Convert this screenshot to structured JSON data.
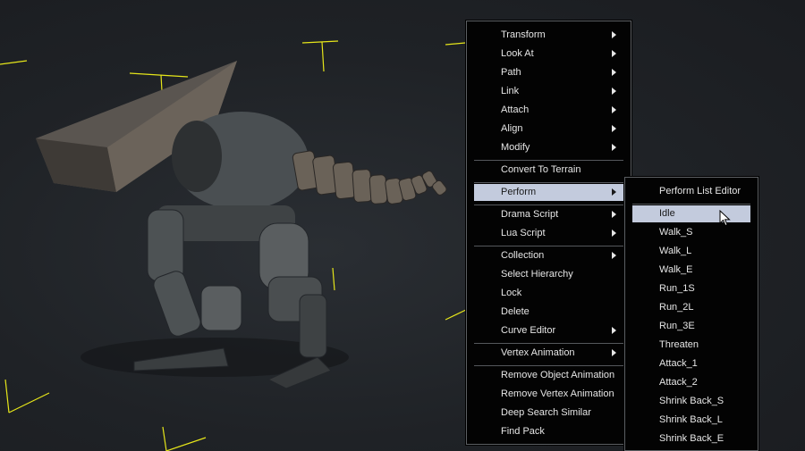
{
  "context_menu": {
    "groups": [
      [
        {
          "label": "Transform",
          "submenu": true
        },
        {
          "label": "Look At",
          "submenu": true
        },
        {
          "label": "Path",
          "submenu": true
        },
        {
          "label": "Link",
          "submenu": true
        },
        {
          "label": "Attach",
          "submenu": true
        },
        {
          "label": "Align",
          "submenu": true
        },
        {
          "label": "Modify",
          "submenu": true
        }
      ],
      [
        {
          "label": "Convert To Terrain",
          "submenu": false
        }
      ],
      [
        {
          "label": "Perform",
          "submenu": true,
          "highlighted": true
        }
      ],
      [
        {
          "label": "Drama Script",
          "submenu": true
        },
        {
          "label": "Lua Script",
          "submenu": true
        }
      ],
      [
        {
          "label": "Collection",
          "submenu": true
        },
        {
          "label": "Select Hierarchy",
          "submenu": false
        },
        {
          "label": "Lock",
          "submenu": false
        },
        {
          "label": "Delete",
          "submenu": false
        },
        {
          "label": "Curve Editor",
          "submenu": true
        }
      ],
      [
        {
          "label": "Vertex Animation",
          "submenu": true
        }
      ],
      [
        {
          "label": "Remove Object Animation",
          "submenu": false
        },
        {
          "label": "Remove Vertex Animation",
          "submenu": false
        },
        {
          "label": "Deep Search Similar",
          "submenu": false
        },
        {
          "label": "Find Pack",
          "submenu": false
        }
      ]
    ]
  },
  "perform_submenu": {
    "groups": [
      [
        {
          "label": "Perform List Editor"
        }
      ],
      [
        {
          "label": "Idle",
          "highlighted": true
        },
        {
          "label": "Walk_S"
        },
        {
          "label": "Walk_L"
        },
        {
          "label": "Walk_E"
        },
        {
          "label": "Run_1S"
        },
        {
          "label": "Run_2L"
        },
        {
          "label": "Run_3E"
        },
        {
          "label": "Threaten"
        },
        {
          "label": "Attack_1"
        },
        {
          "label": "Attack_2"
        },
        {
          "label": "Shrink Back_S"
        },
        {
          "label": "Shrink Back_L"
        },
        {
          "label": "Shrink Back_E"
        }
      ]
    ]
  },
  "colors": {
    "viewport_bg": "#1f2226",
    "menu_bg": "#030303",
    "highlight": "#c3cbdd",
    "gizmo": "#e6e61a"
  }
}
